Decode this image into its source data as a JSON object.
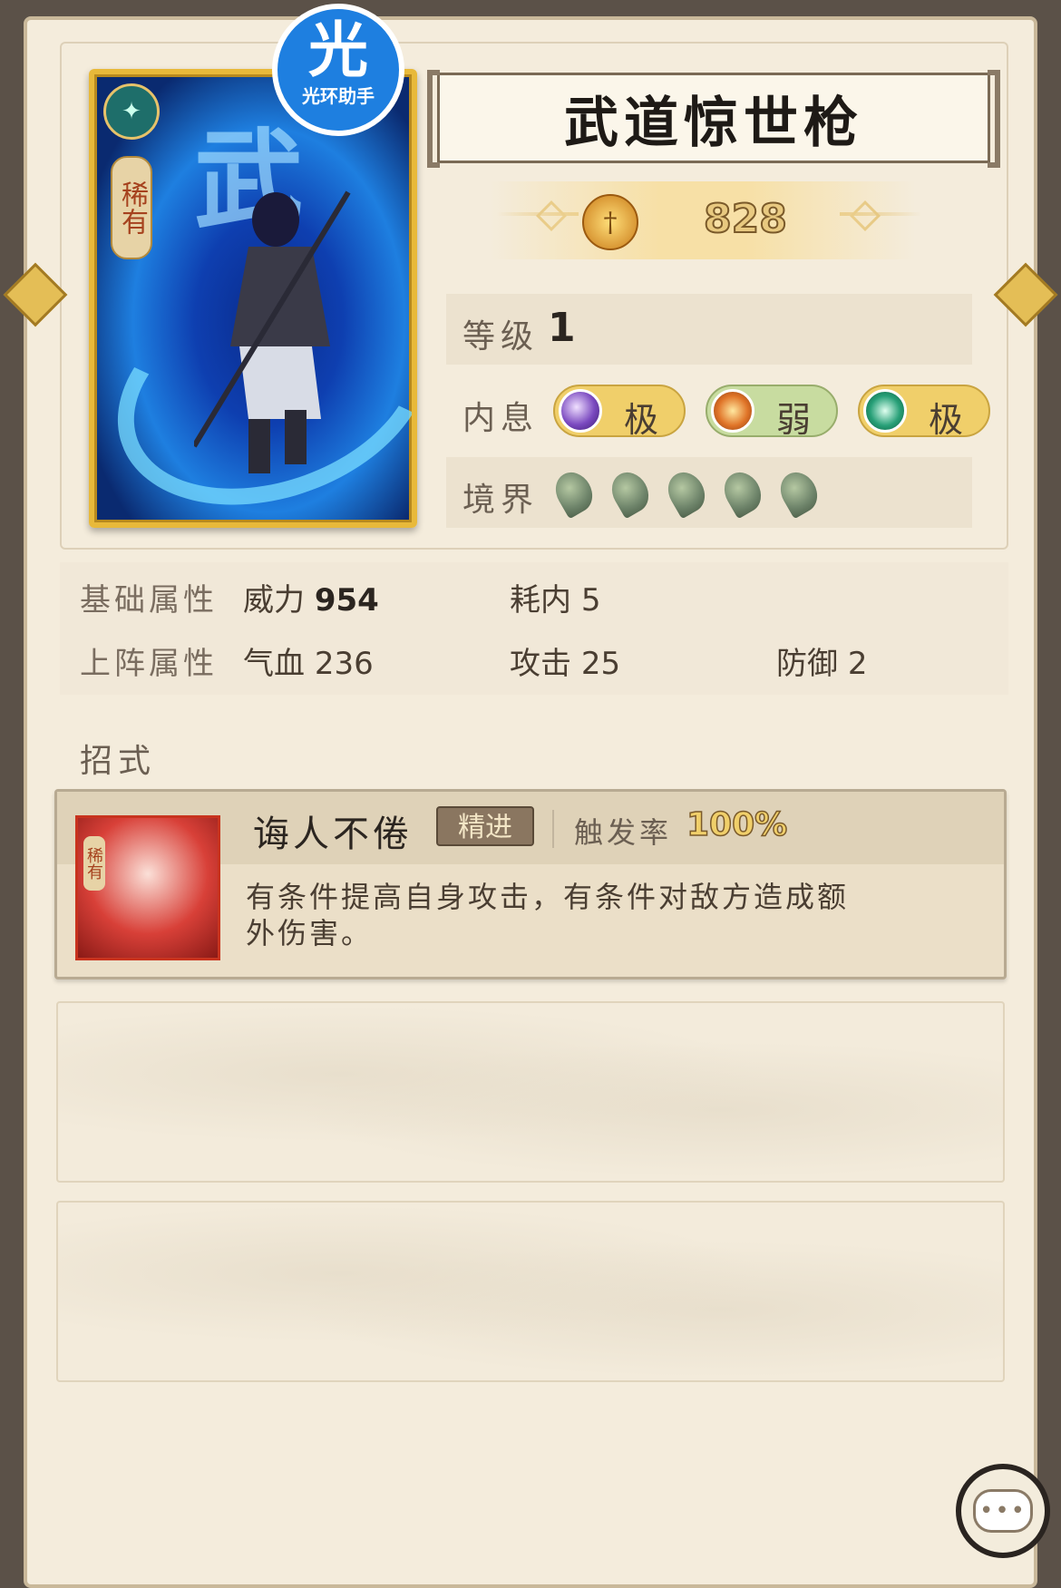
{
  "card": {
    "rarity": "稀有",
    "emblem_icon": "school-emblem-icon",
    "art_char": "武"
  },
  "watermark": {
    "char": "光",
    "text": "光环助手"
  },
  "title": "武道惊世枪",
  "power": {
    "icon": "sword-power-icon",
    "value": "828"
  },
  "level": {
    "label": "等级",
    "value": "1"
  },
  "inner_breath": {
    "label": "内息",
    "items": [
      {
        "icon": "moon-orb-icon",
        "text": "极",
        "color": "#7b4ac0"
      },
      {
        "icon": "sun-orb-icon",
        "text": "弱",
        "color": "#e07428"
      },
      {
        "icon": "jade-orb-icon",
        "text": "极",
        "color": "#28a078"
      }
    ]
  },
  "realm": {
    "label": "境界",
    "count": 5
  },
  "stats": {
    "base_label": "基础属性",
    "power_label": "威力",
    "power_value": "954",
    "cost_label": "耗内",
    "cost_value": "5",
    "battle_label": "上阵属性",
    "hp_label": "气血",
    "hp_value": "236",
    "atk_label": "攻击",
    "atk_value": "25",
    "def_label": "防御",
    "def_value": "2"
  },
  "moves_label": "招式",
  "skill": {
    "icon_tag": "稀有",
    "name": "诲人不倦",
    "badge": "精进",
    "rate_label": "触发率",
    "rate_value": "100%",
    "description": "有条件提高自身攻击，有条件对敌方造成额外伤害。"
  },
  "chat": {
    "icon": "chat-bubble-icon",
    "dots": "•••"
  }
}
